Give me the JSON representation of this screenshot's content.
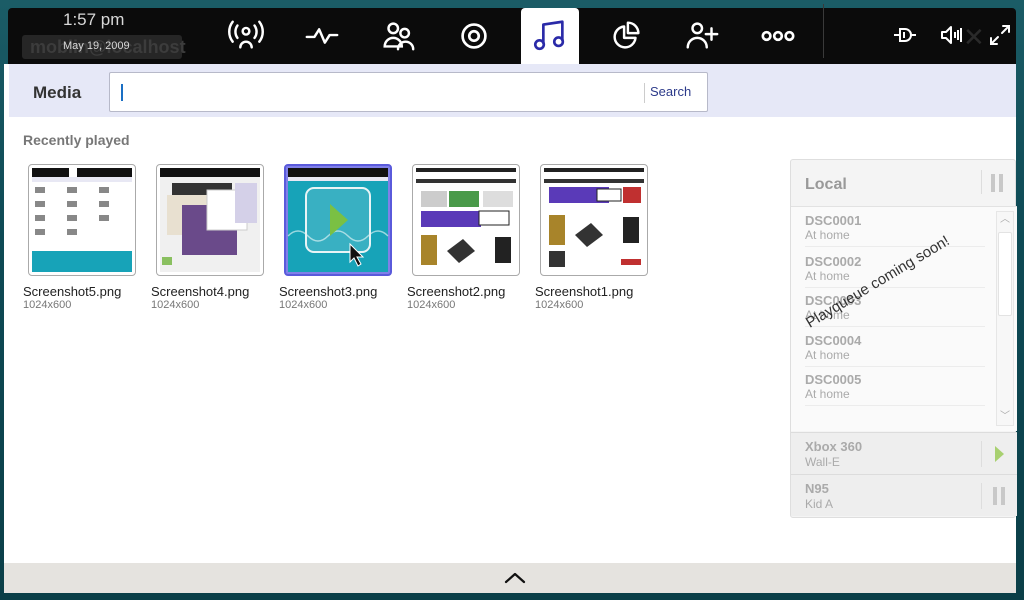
{
  "status": {
    "time": "1:57 pm",
    "date": "May 19, 2009",
    "user_ghost": "moblin@localhost"
  },
  "nav": {
    "items": [
      {
        "name": "myzone",
        "icon": "broadcast-person-icon"
      },
      {
        "name": "status",
        "icon": "pulse-icon"
      },
      {
        "name": "people",
        "icon": "people-icon"
      },
      {
        "name": "internet",
        "icon": "target-icon"
      },
      {
        "name": "media",
        "icon": "music-note-icon",
        "active": true
      },
      {
        "name": "pasteboard",
        "icon": "pie-chart-icon"
      },
      {
        "name": "applications",
        "icon": "add-person-icon"
      },
      {
        "name": "zones",
        "icon": "three-circles-icon"
      }
    ],
    "system_icons": [
      "plug-icon",
      "volume-icon",
      "expand-icon"
    ]
  },
  "media": {
    "label": "Media",
    "search_placeholder": "",
    "search_button": "Search",
    "section_title": "Recently played",
    "items": [
      {
        "name": "Screenshot5.png",
        "size": "1024x600"
      },
      {
        "name": "Screenshot4.png",
        "size": "1024x600"
      },
      {
        "name": "Screenshot3.png",
        "size": "1024x600",
        "selected": true
      },
      {
        "name": "Screenshot2.png",
        "size": "1024x600"
      },
      {
        "name": "Screenshot1.png",
        "size": "1024x600"
      }
    ]
  },
  "queue": {
    "title": "Local",
    "coming_soon": "Playqueue coming soon!",
    "items": [
      {
        "title": "DSC0001",
        "sub": "At home"
      },
      {
        "title": "DSC0002",
        "sub": "At home"
      },
      {
        "title": "DSC0003",
        "sub": "At home"
      },
      {
        "title": "DSC0004",
        "sub": "At home"
      },
      {
        "title": "DSC0005",
        "sub": "At home"
      }
    ],
    "devices": [
      {
        "title": "Xbox 360",
        "sub": "Wall-E",
        "state": "play"
      },
      {
        "title": "N95",
        "sub": "Kid A",
        "state": "pause"
      }
    ]
  },
  "colors": {
    "accent": "#5a5adb",
    "play_green": "#a8d070",
    "top_bg": "#0b0b0b"
  }
}
